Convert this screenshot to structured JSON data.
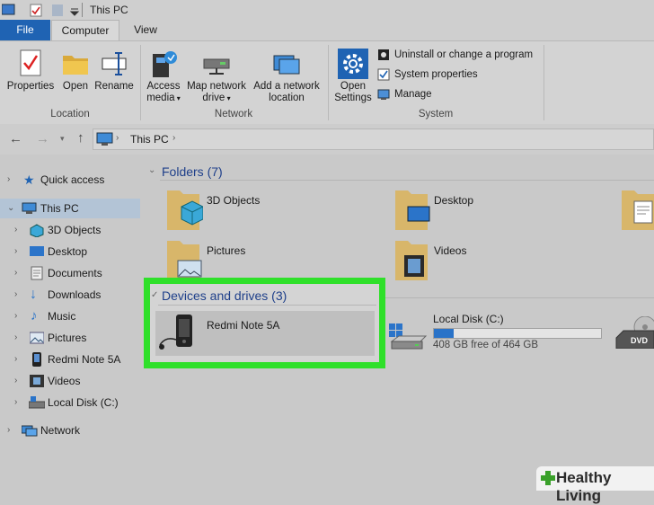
{
  "window": {
    "title": "This PC"
  },
  "tabs": {
    "file": "File",
    "computer": "Computer",
    "view": "View"
  },
  "ribbon": {
    "location": {
      "label": "Location",
      "properties": "Properties",
      "open": "Open",
      "rename": "Rename"
    },
    "network": {
      "label": "Network",
      "access_media": [
        "Access",
        "media"
      ],
      "map_drive": [
        "Map network",
        "drive"
      ],
      "add_location": [
        "Add a network",
        "location"
      ]
    },
    "system": {
      "label": "System",
      "open_settings": [
        "Open",
        "Settings"
      ],
      "uninstall": "Uninstall or change a program",
      "properties": "System properties",
      "manage": "Manage"
    }
  },
  "address": {
    "path": "This PC"
  },
  "nav": {
    "quick_access": "Quick access",
    "this_pc": "This PC",
    "items": [
      "3D Objects",
      "Desktop",
      "Documents",
      "Downloads",
      "Music",
      "Pictures",
      "Redmi Note 5A",
      "Videos",
      "Local Disk (C:)"
    ],
    "network": "Network"
  },
  "folders": {
    "title": "Folders (7)",
    "items": [
      "3D Objects",
      "Desktop",
      "Pictures",
      "Videos"
    ]
  },
  "devices": {
    "title": "Devices and drives (3)",
    "phone": "Redmi Note 5A",
    "disk_name": "Local Disk (C:)",
    "disk_free": "408 GB free of 464 GB",
    "disk_used_fraction": 0.12,
    "dvd_label": "DVD"
  },
  "watermark": {
    "text": "Healthy Living"
  },
  "colors": {
    "highlight": "#2fe02a",
    "accent": "#1f63b3"
  }
}
